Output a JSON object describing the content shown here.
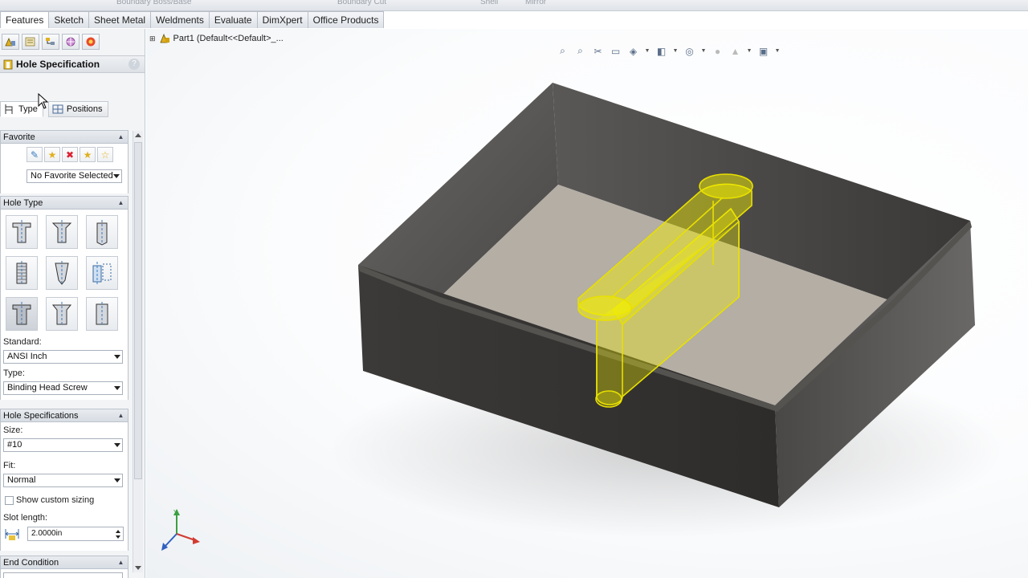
{
  "top_strip": {
    "ghost_items": [
      "Boundary Boss/Base",
      "Boundary Cut",
      "Shell",
      "Mirror"
    ]
  },
  "tabs": [
    {
      "label": "Features",
      "active": true
    },
    {
      "label": "Sketch"
    },
    {
      "label": "Sheet Metal"
    },
    {
      "label": "Weldments"
    },
    {
      "label": "Evaluate"
    },
    {
      "label": "DimXpert"
    },
    {
      "label": "Office Products"
    }
  ],
  "panel": {
    "toolbar_icons": [
      "feature-manager-icon",
      "property-manager-icon",
      "configuration-manager-icon",
      "dimxpert-manager-icon",
      "display-manager-icon"
    ],
    "title": "Hole Specification",
    "help": "?",
    "subtabs": {
      "type": "Type",
      "positions": "Positions"
    },
    "favorite": {
      "header": "Favorite",
      "selected": "No Favorite Selected",
      "icons": [
        "apply-defaults-icon",
        "add-favorite-icon",
        "delete-favorite-icon",
        "save-favorite-icon",
        "load-favorite-icon"
      ]
    },
    "hole_type": {
      "header": "Hole Type",
      "types": [
        "counterbore",
        "countersink",
        "hole",
        "straight-tap",
        "tapered-tap",
        "legacy-hole",
        "counterbore-slot",
        "countersink-slot",
        "slot"
      ],
      "selected_index": 6,
      "standard_label": "Standard:",
      "standard_value": "ANSI Inch",
      "type_label": "Type:",
      "type_value": "Binding Head Screw"
    },
    "hole_specs": {
      "header": "Hole Specifications",
      "size_label": "Size:",
      "size_value": "#10",
      "fit_label": "Fit:",
      "fit_value": "Normal",
      "custom_sizing_label": "Show custom sizing",
      "slot_length_label": "Slot length:",
      "slot_length_value": "2.0000in"
    },
    "end_condition": {
      "header": "End Condition"
    }
  },
  "viewport": {
    "tree_label": "Part1  (Default<<Default>_...",
    "heads_up_icons": [
      "zoom-to-fit-icon",
      "zoom-to-area-icon",
      "previous-view-icon",
      "section-view-icon",
      "view-orientation-icon",
      "display-style-icon",
      "hide-show-items-icon",
      "edit-appearance-icon",
      "apply-scene-icon",
      "view-settings-icon"
    ],
    "triad": {
      "y_label": "Y"
    },
    "colors": {
      "box_dark": "#3a3836",
      "box_floor": "#b4aea5",
      "preview": "#f3f000"
    }
  }
}
